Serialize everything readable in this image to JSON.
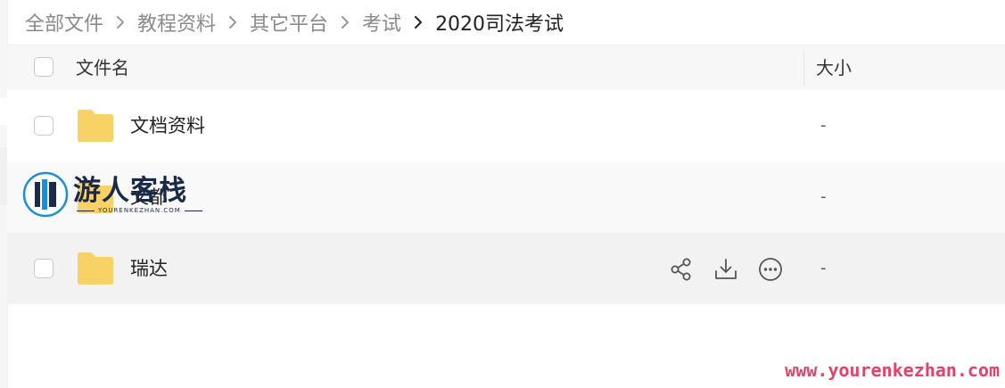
{
  "breadcrumb": {
    "items": [
      "全部文件",
      "教程资料",
      "其它平台",
      "考试"
    ],
    "current": "2020司法考试"
  },
  "table": {
    "columns": {
      "name": "文件名",
      "size": "大小"
    },
    "rows": [
      {
        "name": "文档资料",
        "size": "-",
        "icon": "folder-icon"
      },
      {
        "name": "文都",
        "size": "-",
        "icon": "folder-icon"
      },
      {
        "name": "瑞达",
        "size": "-",
        "icon": "folder-icon",
        "hovered": true
      }
    ]
  },
  "row_actions": [
    "share-icon",
    "download-icon",
    "more-icon"
  ],
  "watermark": {
    "logo_text": "游人客栈",
    "logo_subtext": "YOURENKEZHAN.COM",
    "url": "www.yourenkezhan.com"
  },
  "colors": {
    "folder": "#f8d264",
    "watermark_url": "#e0436b",
    "current_crumb": "#222222",
    "crumb": "#8a8a8a"
  }
}
